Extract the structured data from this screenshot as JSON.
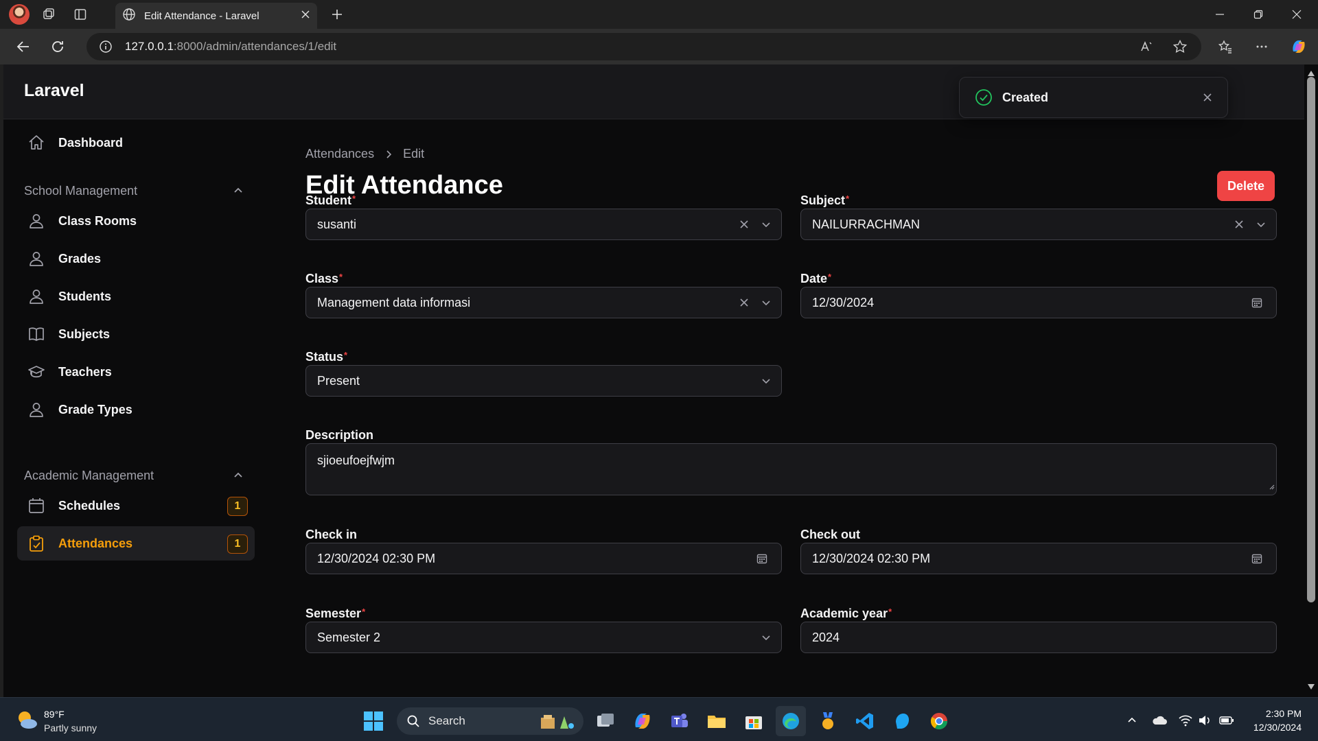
{
  "browser": {
    "tab_title": "Edit Attendance - Laravel",
    "url_host": "127.0.0.1",
    "url_path": ":8000/admin/attendances/1/edit"
  },
  "app": {
    "brand": "Laravel"
  },
  "toast": {
    "message": "Created"
  },
  "sidebar": {
    "dashboard": "Dashboard",
    "groups": [
      {
        "label": "School Management",
        "items": [
          {
            "label": "Class Rooms",
            "icon": "user-icon"
          },
          {
            "label": "Grades",
            "icon": "user-icon"
          },
          {
            "label": "Students",
            "icon": "user-icon"
          },
          {
            "label": "Subjects",
            "icon": "book-icon"
          },
          {
            "label": "Teachers",
            "icon": "academic-cap-icon"
          },
          {
            "label": "Grade Types",
            "icon": "user-icon"
          }
        ]
      },
      {
        "label": "Academic Management",
        "items": [
          {
            "label": "Schedules",
            "icon": "calendar-icon",
            "badge": "1"
          },
          {
            "label": "Attendances",
            "icon": "clipboard-icon",
            "badge": "1",
            "active": true
          }
        ]
      }
    ]
  },
  "breadcrumb": {
    "parent": "Attendances",
    "current": "Edit"
  },
  "page": {
    "title": "Edit Attendance",
    "delete_label": "Delete"
  },
  "form": {
    "student": {
      "label": "Student",
      "value": "susanti"
    },
    "subject": {
      "label": "Subject",
      "value": "NAILURRACHMAN"
    },
    "class": {
      "label": "Class",
      "value": "Management data informasi"
    },
    "date": {
      "label": "Date",
      "value": "12/30/2024"
    },
    "status": {
      "label": "Status",
      "value": "Present"
    },
    "description": {
      "label": "Description",
      "value": "sjioeufoejfwjm"
    },
    "check_in": {
      "label": "Check in",
      "value": "12/30/2024 02:30 PM"
    },
    "check_out": {
      "label": "Check out",
      "value": "12/30/2024 02:30 PM"
    },
    "semester": {
      "label": "Semester",
      "value": "Semester 2"
    },
    "academic_year": {
      "label": "Academic year",
      "value": "2024"
    },
    "required_mark": "*"
  },
  "taskbar": {
    "weather_temp": "89°F",
    "weather_desc": "Partly sunny",
    "search_label": "Search",
    "time": "2:30 PM",
    "date": "12/30/2024"
  },
  "colors": {
    "accent": "#f59e0b",
    "danger": "#ef4444",
    "success": "#22c55e",
    "background": "#0b0b0c"
  }
}
